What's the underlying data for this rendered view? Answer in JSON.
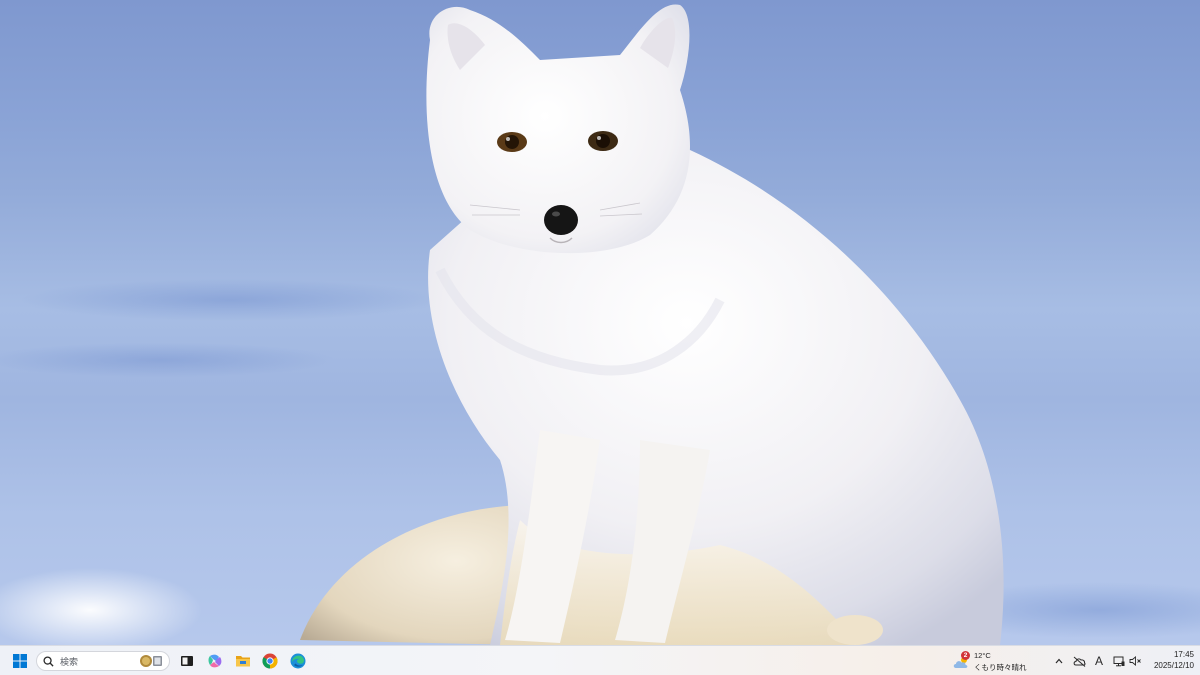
{
  "desktop": {
    "wallpaper_icon": "arctic-fox-wallpaper"
  },
  "taskbar": {
    "start_icon": "windows-start-icon",
    "search": {
      "placeholder": "検索",
      "icon": "search-icon"
    },
    "pinned_apps": [
      {
        "name": "task-view",
        "icon": "task-view-icon"
      },
      {
        "name": "copilot",
        "icon": "copilot-icon"
      },
      {
        "name": "file-explorer",
        "icon": "folder-icon"
      },
      {
        "name": "chrome",
        "icon": "chrome-icon"
      },
      {
        "name": "edge",
        "icon": "edge-icon"
      }
    ],
    "weather": {
      "badge": "2",
      "temperature": "12°C",
      "condition": "くもり時々晴れ",
      "icon": "cloudy-sun-icon"
    },
    "tray": {
      "overflow_icon": "chevron-up-icon",
      "onedrive_icon": "cloud-off-icon",
      "ime_label": "A",
      "network_icon": "network-icon",
      "volume_icon": "volume-muted-icon"
    },
    "clock": {
      "time": "17:45",
      "date": "2025/12/10"
    }
  },
  "colors": {
    "accent_blue": "#0078d4",
    "badge_red": "#d13438",
    "taskbar_bg": "#f3f4f8"
  }
}
